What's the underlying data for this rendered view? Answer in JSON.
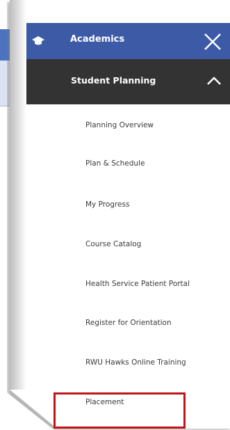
{
  "nav": {
    "section": "Academics",
    "subsection": "Student Planning",
    "items": [
      "Planning Overview",
      "Plan & Schedule",
      "My Progress",
      "Course Catalog",
      "Health Service Patient Portal",
      "Register for Orientation",
      "RWU Hawks Online Training",
      "Placement"
    ]
  },
  "colors": {
    "academics": "#3d5aa6",
    "student_planning": "#333333",
    "highlight": "#c0141a"
  },
  "icons": {
    "section": "graduation-cap-icon",
    "close": "close-icon",
    "collapse": "chevron-up-icon"
  }
}
